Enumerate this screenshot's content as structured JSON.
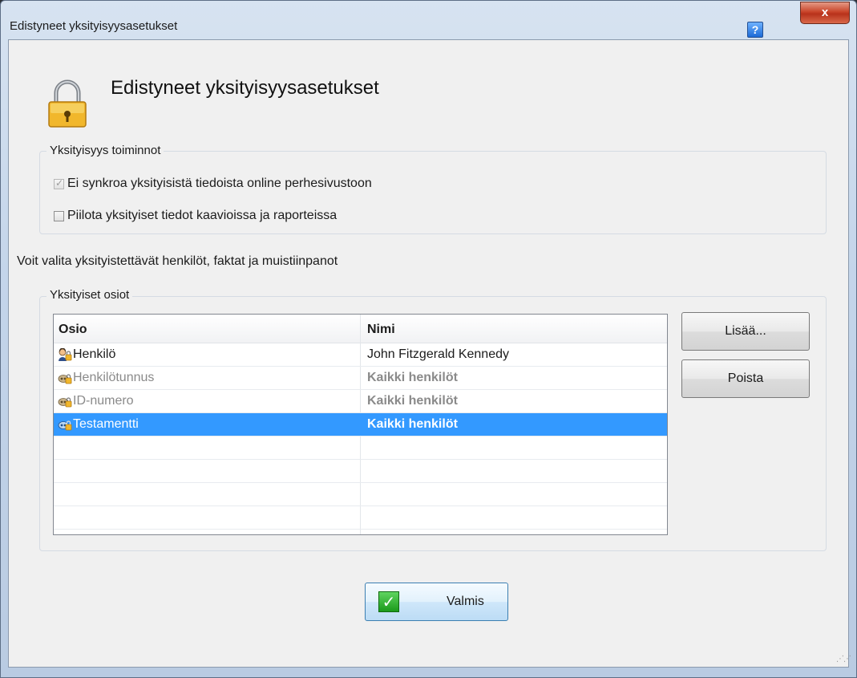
{
  "window": {
    "title": "Edistyneet yksityisyysasetukset",
    "help_glyph": "?",
    "close_glyph": "x"
  },
  "header": {
    "title": "Edistyneet yksityisyysasetukset",
    "icon": "lock-icon"
  },
  "privacy_functions": {
    "legend": "Yksityisyys toiminnot",
    "options": [
      {
        "label": "Ei synkroa yksityisistä tiedoista online perhesivustoon",
        "checked": true,
        "disabled": true
      },
      {
        "label": "Piilota yksityiset tiedot kaavioissa ja raporteissa",
        "checked": false,
        "disabled": false
      }
    ]
  },
  "info_text": "Voit valita yksityistettävät henkilöt, faktat ja muistiinpanot",
  "private_sections": {
    "legend": "Yksityiset osiot",
    "columns": [
      "Osio",
      "Nimi"
    ],
    "rows": [
      {
        "section": "Henkilö",
        "name": "John Fitzgerald Kennedy",
        "icon": "person-icon",
        "dimmed": false,
        "selected": false
      },
      {
        "section": "Henkilötunnus",
        "name": "Kaikki henkilöt",
        "icon": "fact-icon",
        "dimmed": true,
        "selected": false
      },
      {
        "section": "ID-numero",
        "name": "Kaikki henkilöt",
        "icon": "fact-icon",
        "dimmed": true,
        "selected": false
      },
      {
        "section": "Testamentti",
        "name": "Kaikki henkilöt",
        "icon": "fact-icon",
        "dimmed": false,
        "selected": true
      }
    ],
    "buttons": {
      "add": "Lisää...",
      "remove": "Poista"
    }
  },
  "footer": {
    "done": "Valmis"
  },
  "colors": {
    "selection": "#3399ff",
    "close_button": "#c9452a",
    "window_chrome": "#c4d5ea"
  }
}
